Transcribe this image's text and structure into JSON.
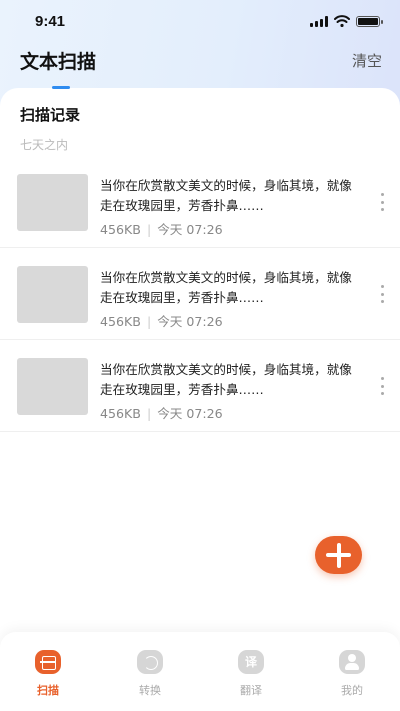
{
  "status_bar": {
    "time": "9:41"
  },
  "header": {
    "title": "文本扫描",
    "clear_label": "清空"
  },
  "section": {
    "title": "扫描记录",
    "subtitle": "七天之内"
  },
  "records": [
    {
      "text": "当你在欣赏散文美文的时候，身临其境，就像走在玫瑰园里，芳香扑鼻……",
      "size": "456KB",
      "time": "今天 07:26"
    },
    {
      "text": "当你在欣赏散文美文的时候，身临其境，就像走在玫瑰园里，芳香扑鼻……",
      "size": "456KB",
      "time": "今天 07:26"
    },
    {
      "text": "当你在欣赏散文美文的时候，身临其境，就像走在玫瑰园里，芳香扑鼻……",
      "size": "456KB",
      "time": "今天 07:26"
    }
  ],
  "tabs": [
    {
      "label": "扫描",
      "icon": "scan-icon",
      "active": true
    },
    {
      "label": "转换",
      "icon": "convert-icon",
      "active": false
    },
    {
      "label": "翻译",
      "icon": "translate-icon",
      "icon_glyph": "译",
      "active": false
    },
    {
      "label": "我的",
      "icon": "profile-icon",
      "active": false
    }
  ],
  "colors": {
    "accent": "#e8612c",
    "highlight": "#2f8cf0"
  }
}
